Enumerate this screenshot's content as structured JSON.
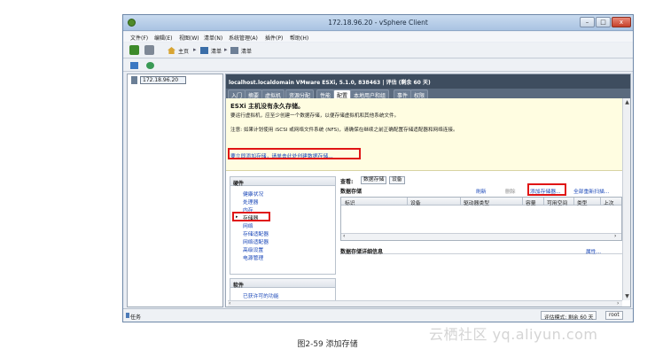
{
  "window": {
    "title": "172.18.96.20 - vSphere Client",
    "minimize": "–",
    "maximize": "□",
    "close": "x"
  },
  "menu": [
    "文件(F)",
    "编辑(E)",
    "视图(W)",
    "清单(N)",
    "系统管理(A)",
    "插件(P)",
    "帮助(H)"
  ],
  "nav": {
    "home": "主页",
    "sep": "▸",
    "inventory1": "清单",
    "inventory2": "清单"
  },
  "tree": {
    "host": "172.18.96.20"
  },
  "host_header": "localhost.localdomain VMware ESXi, 5.1.0, 838463 | 评估 (剩余 60 天)",
  "tabs": [
    "入门",
    "摘要",
    "虚拟机",
    "资源分配",
    "性能",
    "配置",
    "本地用户和组",
    "事件",
    "权限"
  ],
  "warning": {
    "title": "ESXi 主机没有永久存储。",
    "line1": "要运行虚拟机，应至少创建一个数据存储，以便存储虚拟机和其他系统文件。",
    "line2": "注意: 如果计划使用 iSCSI 或网络文件系统 (NFS)，请确保在继续之前正确配置存储适配器和网络连接。",
    "link": "要立即添加存储，请单击此处创建数据存储..."
  },
  "hardware": {
    "title": "硬件",
    "items": [
      "健康状况",
      "处理器",
      "内存",
      "存储器",
      "网络",
      "存储适配器",
      "网络适配器",
      "高级设置",
      "电源管理"
    ],
    "bullet": "▸"
  },
  "software": {
    "title": "软件",
    "items": [
      "已获许可的功能"
    ]
  },
  "view": {
    "label": "查看:",
    "datastore": "数据存储",
    "device": "设备"
  },
  "datastores": {
    "title": "数据存储",
    "refresh": "刷新",
    "delete": "删除",
    "add": "添加存储器...",
    "rescan": "全部重新扫描...",
    "columns": [
      "标识",
      "设备",
      "驱动器类型",
      "容量",
      "可用空间",
      "类型",
      "上次"
    ]
  },
  "details": {
    "title": "数据存储详细信息",
    "props": "属性..."
  },
  "status": {
    "tasks": "任务",
    "eval": "评估模式: 剩余 60 天",
    "user": "root"
  },
  "caption": "图2-59 添加存储",
  "watermark": "云栖社区 yq.aliyun.com",
  "colors": {
    "accent_red": "#e01515",
    "link_blue": "#1a47b8",
    "header_dark": "#3e4d5f"
  },
  "icons": [
    "back-icon",
    "forward-icon",
    "home-icon",
    "inventory-icon",
    "host-icon",
    "tasks-icon"
  ]
}
